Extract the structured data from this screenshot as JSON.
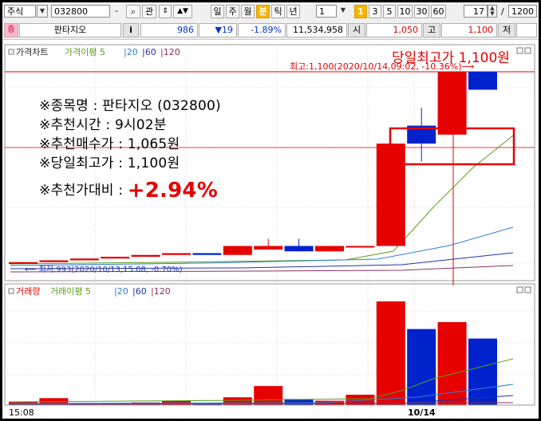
{
  "toolbar": {
    "market": "주식",
    "code": "032800",
    "search_icon_label": "⌕",
    "gwan": "관",
    "periods": [
      "일",
      "주",
      "월",
      "분",
      "틱",
      "년"
    ],
    "active_period": "분",
    "interval_value": "1",
    "minute_options": [
      "1",
      "3",
      "5",
      "10",
      "30",
      "60"
    ],
    "active_minute": "1",
    "count_value": "17",
    "total_value": "1200",
    "slash": "/"
  },
  "quote": {
    "marker": "증",
    "name": "판타지오",
    "info_btn": "i",
    "price": "986",
    "change": "▼19",
    "change_pct": "-1.89%",
    "volume": "11,534,958",
    "open_label": "시",
    "open_value": "1,050",
    "high_label": "고",
    "high_value": "1,100",
    "low_label": "저"
  },
  "chart": {
    "price_title": "가격차트",
    "ma_title": "가격이평",
    "ma_periods": [
      "5",
      "20",
      "60",
      "120"
    ],
    "vol_title": "거래량",
    "vol_ma_title": "거래이평",
    "vol_ma_periods": [
      "5",
      "20",
      "60",
      "120"
    ],
    "high_note": "최고:1,100(2020/10/14,09:02, -10.36%)⟶",
    "low_note": "⟵ 최저:993(2020/10/13,15:08, -0.70%)",
    "x_labels": [
      "15:08",
      "10/14"
    ],
    "colors": {
      "up": "#e60000",
      "down": "#0022cc",
      "ma5": "#5a9e1a",
      "ma20": "#2b7fd6",
      "ma60": "#2233aa",
      "ma120": "#8a3060"
    }
  },
  "overlay": {
    "headline": "당일최고가 1,100원",
    "lines": [
      "※종목명 : 판타지오 (032800)",
      "※추천시간 : 9시02분",
      "※추천매수가 : 1,065원",
      "※당일최고가 : 1,100원"
    ],
    "return_label": "※추천가대비 : ",
    "return_value": "+2.94%"
  },
  "chart_data": {
    "type": "candlestick",
    "x": [
      "15:08",
      "",
      "",
      "",
      "",
      "",
      "",
      "",
      "",
      "",
      "",
      "",
      "",
      "",
      "",
      "10/14",
      "",
      ""
    ],
    "series": [
      {
        "open": 993,
        "high": 994,
        "low": 993,
        "close": 994,
        "dir": "up"
      },
      {
        "open": 994,
        "high": 995,
        "low": 994,
        "close": 995,
        "dir": "up"
      },
      {
        "open": 995,
        "high": 996,
        "low": 995,
        "close": 996,
        "dir": "up"
      },
      {
        "open": 996,
        "high": 997,
        "low": 996,
        "close": 997,
        "dir": "up"
      },
      {
        "open": 997,
        "high": 998,
        "low": 997,
        "close": 998,
        "dir": "up"
      },
      {
        "open": 998,
        "high": 999,
        "low": 998,
        "close": 999,
        "dir": "up"
      },
      {
        "open": 999,
        "high": 998,
        "low": 998,
        "close": 998,
        "dir": "down"
      },
      {
        "open": 998,
        "high": 1003,
        "low": 998,
        "close": 1003,
        "dir": "up"
      },
      {
        "open": 1003,
        "high": 1007,
        "low": 1001,
        "close": 1001,
        "dir": "up"
      },
      {
        "open": 1003,
        "high": 1007,
        "low": 1000,
        "close": 1000,
        "dir": "down"
      },
      {
        "open": 1000,
        "high": 1003,
        "low": 1000,
        "close": 1003,
        "dir": "up"
      },
      {
        "open": 1003,
        "high": 1003,
        "low": 1003,
        "close": 1003,
        "dir": "up"
      },
      {
        "open": 1003,
        "high": 1060,
        "low": 1050,
        "close": 1060,
        "dir": "up"
      },
      {
        "open": 1060,
        "high": 1080,
        "low": 1050,
        "close": 1070,
        "dir": "down"
      },
      {
        "open": 1065,
        "high": 1100,
        "low": 1065,
        "close": 1100,
        "dir": "up"
      },
      {
        "open": 1100,
        "high": 1100,
        "low": 1090,
        "close": 1090,
        "dir": "down"
      }
    ],
    "volume": [
      {
        "v": 4,
        "dir": "up"
      },
      {
        "v": 8,
        "dir": "up"
      },
      {
        "v": 2,
        "dir": "up"
      },
      {
        "v": 2,
        "dir": "up"
      },
      {
        "v": 3,
        "dir": "up"
      },
      {
        "v": 5,
        "dir": "up"
      },
      {
        "v": 2,
        "dir": "down"
      },
      {
        "v": 9,
        "dir": "up"
      },
      {
        "v": 22,
        "dir": "up"
      },
      {
        "v": 7,
        "dir": "down"
      },
      {
        "v": 5,
        "dir": "up"
      },
      {
        "v": 12,
        "dir": "up"
      },
      {
        "v": 120,
        "dir": "up"
      },
      {
        "v": 88,
        "dir": "down"
      },
      {
        "v": 96,
        "dir": "up"
      },
      {
        "v": 77,
        "dir": "down"
      }
    ]
  }
}
